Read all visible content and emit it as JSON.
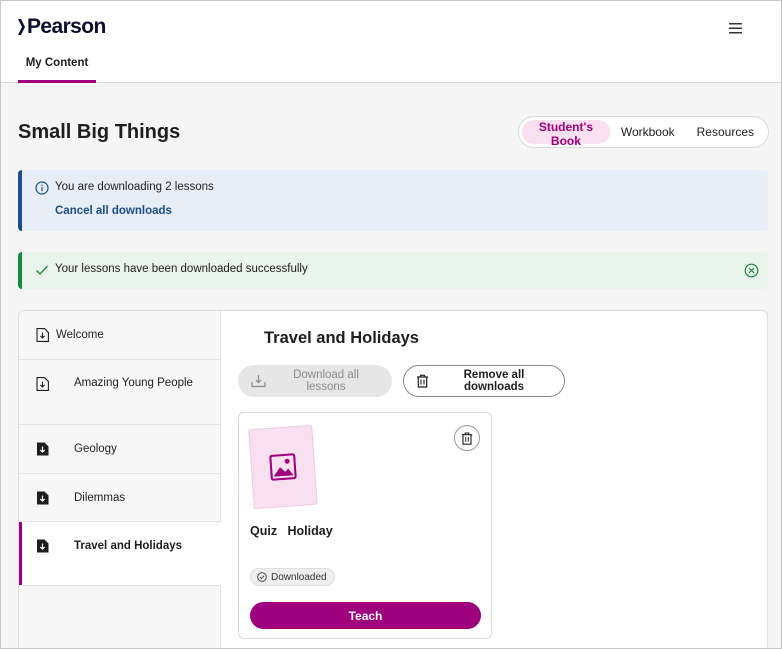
{
  "brand": {
    "name": "Pearson"
  },
  "header": {
    "active_tab": "My Content"
  },
  "page": {
    "title": "Small Big Things"
  },
  "book_tabs": [
    {
      "label": "Student's Book",
      "active": true
    },
    {
      "label": "Workbook",
      "active": false
    },
    {
      "label": "Resources",
      "active": false
    }
  ],
  "alerts": {
    "info": {
      "message": "You are downloading 2 lessons",
      "link": "Cancel all downloads"
    },
    "success": {
      "message": "Your lessons have been downloaded successfully"
    }
  },
  "sidebar": {
    "items": [
      {
        "label": "Welcome",
        "icon": "download-file-outline-icon"
      },
      {
        "label": "Amazing Young People",
        "icon": "download-file-outline-icon"
      },
      {
        "label": "Geology",
        "icon": "downloaded-file-icon"
      },
      {
        "label": "Dilemmas",
        "icon": "downloaded-file-icon"
      },
      {
        "label": "Travel and Holidays",
        "icon": "downloaded-file-icon",
        "active": true
      }
    ]
  },
  "content": {
    "title": "Travel and Holidays",
    "download_all_label": "Download all lessons",
    "remove_all_label": "Remove all downloads"
  },
  "lesson_card": {
    "title": "Quiz   Holiday",
    "status": "Downloaded",
    "action": "Teach"
  },
  "colors": {
    "accent": "#9e007e",
    "accent_light": "#f9e0f0",
    "info": "#1a4e8a",
    "success": "#188a3c"
  }
}
